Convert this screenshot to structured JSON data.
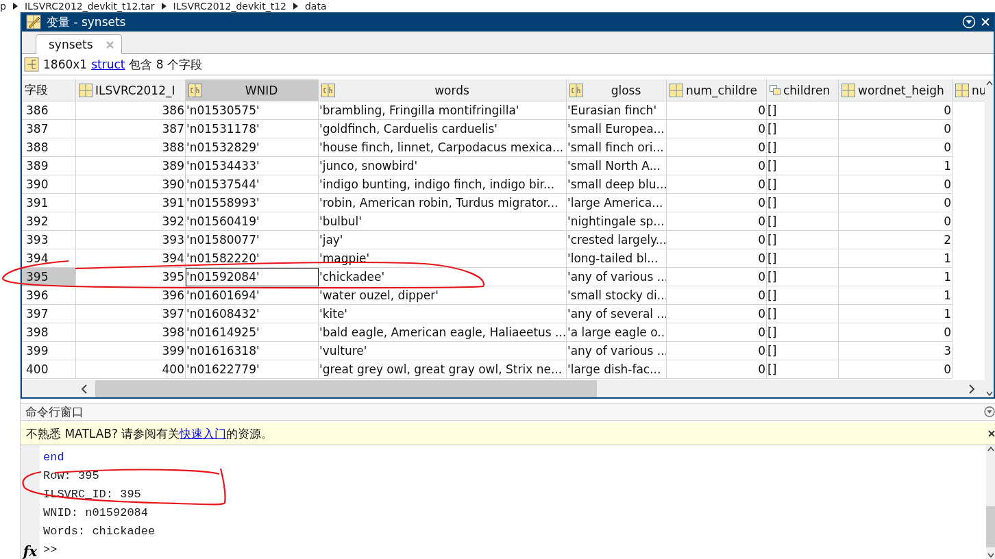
{
  "breadcrumb": [
    "p",
    "ILSVRC2012_devkit_t12.tar",
    "ILSVRC2012_devkit_t12",
    "data"
  ],
  "window": {
    "title": "变量 - synsets"
  },
  "tabs": [
    {
      "label": "synsets",
      "selected": true
    }
  ],
  "summary": {
    "size": "1860x1",
    "link": "struct",
    "rest": "包含 8 个字段"
  },
  "table": {
    "columns": [
      {
        "label": "字段",
        "kind": "rowheader",
        "selected": false
      },
      {
        "label": "ILSVRC2012_I",
        "kind": "numeric",
        "selected": false
      },
      {
        "label": "WNID",
        "kind": "char",
        "selected": true
      },
      {
        "label": "words",
        "kind": "char",
        "selected": false
      },
      {
        "label": "gloss",
        "kind": "char",
        "selected": false
      },
      {
        "label": "num_childre",
        "kind": "numeric",
        "selected": false
      },
      {
        "label": "children",
        "kind": "cell",
        "selected": false
      },
      {
        "label": "wordnet_heigh",
        "kind": "numeric",
        "selected": false
      },
      {
        "label": "nu",
        "kind": "numeric",
        "selected": false
      }
    ],
    "rows": [
      {
        "cells": [
          "386",
          "386",
          "'n01530575'",
          "'brambling, Fringilla montifringilla'",
          "'Eurasian finch'",
          "0",
          "[]",
          "0"
        ],
        "selected": false
      },
      {
        "cells": [
          "387",
          "387",
          "'n01531178'",
          "'goldfinch, Carduelis carduelis'",
          "'small Europea...",
          "0",
          "[]",
          "0"
        ],
        "selected": false
      },
      {
        "cells": [
          "388",
          "388",
          "'n01532829'",
          "'house finch, linnet, Carpodacus mexica...",
          "'small finch ori...",
          "0",
          "[]",
          "0"
        ],
        "selected": false
      },
      {
        "cells": [
          "389",
          "389",
          "'n01534433'",
          "'junco, snowbird'",
          "'small North A...",
          "0",
          "[]",
          "1"
        ],
        "selected": false
      },
      {
        "cells": [
          "390",
          "390",
          "'n01537544'",
          "'indigo bunting, indigo finch, indigo bir...",
          "'small deep blu...",
          "0",
          "[]",
          "0"
        ],
        "selected": false
      },
      {
        "cells": [
          "391",
          "391",
          "'n01558993'",
          "'robin, American robin, Turdus migrator...",
          "'large America...",
          "0",
          "[]",
          "0"
        ],
        "selected": false
      },
      {
        "cells": [
          "392",
          "392",
          "'n01560419'",
          "'bulbul'",
          "'nightingale sp...",
          "0",
          "[]",
          "0"
        ],
        "selected": false
      },
      {
        "cells": [
          "393",
          "393",
          "'n01580077'",
          "'jay'",
          "'crested largely...",
          "0",
          "[]",
          "2"
        ],
        "selected": false
      },
      {
        "cells": [
          "394",
          "394",
          "'n01582220'",
          "'magpie'",
          "'long-tailed bl...",
          "0",
          "[]",
          "1"
        ],
        "selected": false
      },
      {
        "cells": [
          "395",
          "395",
          "'n01592084'",
          "'chickadee'",
          "'any of various ...",
          "0",
          "[]",
          "1"
        ],
        "selected": true
      },
      {
        "cells": [
          "396",
          "396",
          "'n01601694'",
          "'water ouzel, dipper'",
          "'small stocky di...",
          "0",
          "[]",
          "1"
        ],
        "selected": false
      },
      {
        "cells": [
          "397",
          "397",
          "'n01608432'",
          "'kite'",
          "'any of several ...",
          "0",
          "[]",
          "1"
        ],
        "selected": false
      },
      {
        "cells": [
          "398",
          "398",
          "'n01614925'",
          "'bald eagle, American eagle, Haliaeetus ...",
          "'a large eagle o...",
          "0",
          "[]",
          "0"
        ],
        "selected": false
      },
      {
        "cells": [
          "399",
          "399",
          "'n01616318'",
          "'vulture'",
          "'any of various ...",
          "0",
          "[]",
          "3"
        ],
        "selected": false
      },
      {
        "cells": [
          "400",
          "400",
          "'n01622779'",
          "'great grey owl, great gray owl, Strix ne...",
          "'large dish-fac...",
          "0",
          "[]",
          "0"
        ],
        "selected": false
      }
    ]
  },
  "command_window": {
    "title": "命令行窗口",
    "notice": {
      "before": "不熟悉 MATLAB? 请参阅有关",
      "link": "快速入门",
      "after": "的资源。"
    },
    "lines": [
      {
        "kind": "keyword",
        "text": "end"
      },
      {
        "kind": "output",
        "text": "Row: 395"
      },
      {
        "kind": "output",
        "text": "ILSVRC_ID: 395"
      },
      {
        "kind": "output",
        "text": "WNID: n01592084"
      },
      {
        "kind": "output",
        "text": "Words: chickadee"
      }
    ],
    "function_button": "fx",
    "prompt": ">>"
  }
}
